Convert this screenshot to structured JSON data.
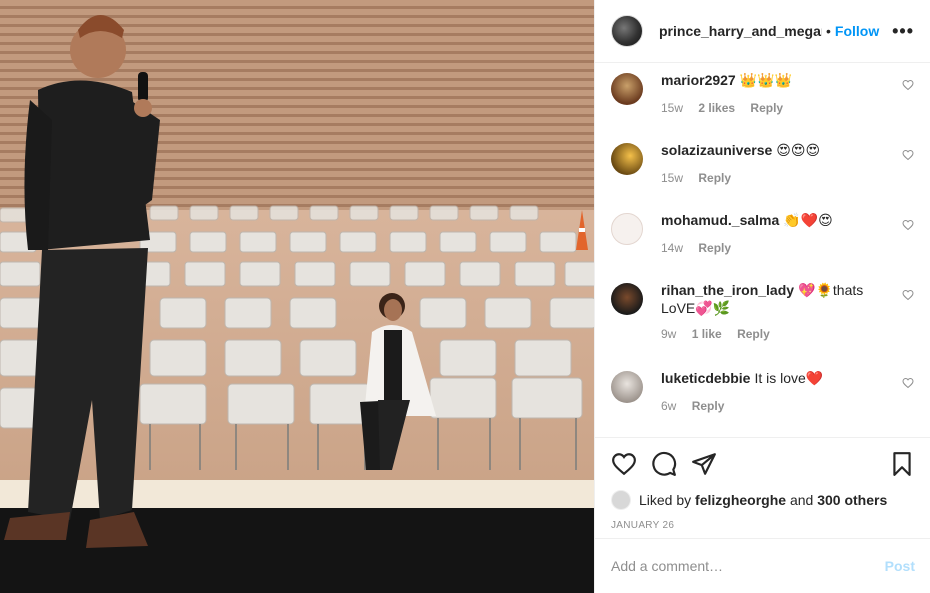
{
  "post": {
    "username": "prince_harry_and_megan",
    "dot": "•",
    "follow_label": "Follow",
    "more_label": "•••"
  },
  "comments": [
    {
      "username": "marior2927",
      "text": "👑👑👑",
      "time": "15w",
      "likes": "2 likes",
      "reply": "Reply"
    },
    {
      "username": "solazizauniverse",
      "text": "😍😍😍",
      "time": "15w",
      "likes": "",
      "reply": "Reply"
    },
    {
      "username": "mohamud._salma",
      "text": "👏❤️😍",
      "time": "14w",
      "likes": "",
      "reply": "Reply"
    },
    {
      "username": "rihan_the_iron_lady",
      "text": "💖🌻thats LoVE💞🌿",
      "time": "9w",
      "likes": "1 like",
      "reply": "Reply"
    },
    {
      "username": "luketicdebbie",
      "text": "It is love❤️",
      "time": "6w",
      "likes": "",
      "reply": "Reply"
    }
  ],
  "likes_line": {
    "prefix": "Liked by ",
    "user": "felizgheorghe",
    "middle": " and ",
    "count": "300 others"
  },
  "date": "JANUARY 26",
  "add_comment": {
    "placeholder": "Add a comment…",
    "post_label": "Post"
  },
  "icons": [
    "heart-icon",
    "comment-icon",
    "share-icon",
    "bookmark-icon",
    "more-icon"
  ],
  "colors": {
    "accent": "#0095f6",
    "post_disabled": "#b2dffc",
    "muted": "#8e8e8e"
  }
}
